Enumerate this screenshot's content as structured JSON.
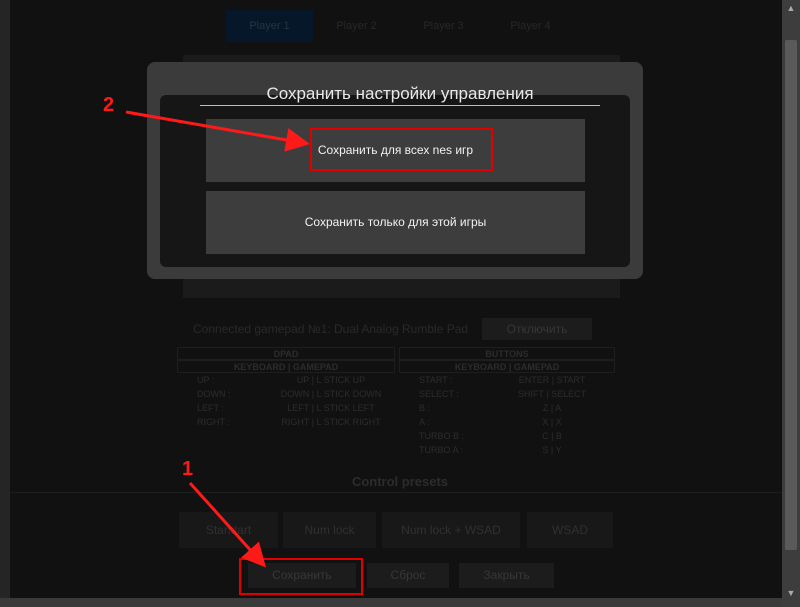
{
  "tabs": [
    "Player 1",
    "Player 2",
    "Player 3",
    "Player 4"
  ],
  "gamepad": {
    "connected_text": "Connected gamepad №1: Dual Analog Rumble Pad",
    "disconnect_label": "Отключить"
  },
  "dpad": {
    "title": "DPAD",
    "subtitle": "KEYBOARD | GAMEPAD",
    "rows": [
      {
        "key": "UP :",
        "value": "UP | L STICK UP"
      },
      {
        "key": "DOWN :",
        "value": "DOWN | L STICK DOWN"
      },
      {
        "key": "LEFT :",
        "value": "LEFT | L STICK LEFT"
      },
      {
        "key": "RIGHT :",
        "value": "RIGHT | L STICK RIGHT"
      }
    ]
  },
  "buttons": {
    "title": "BUTTONS",
    "subtitle": "KEYBOARD | GAMEPAD",
    "rows": [
      {
        "key": "START :",
        "value": "ENTER | START"
      },
      {
        "key": "SELECT :",
        "value": "SHIFT | SELECT"
      },
      {
        "key": "B :",
        "value": "Z | A"
      },
      {
        "key": "A :",
        "value": "X | X"
      },
      {
        "key": "TURBO B :",
        "value": "C | B"
      },
      {
        "key": "TURBO A :",
        "value": "S | Y"
      }
    ]
  },
  "presets": {
    "title": "Control presets",
    "items": [
      "Standart",
      "Num lock",
      "Num lock + WSAD",
      "WSAD"
    ]
  },
  "bottom": {
    "save": "Сохранить",
    "reset": "Сброс",
    "close": "Закрыть"
  },
  "modal": {
    "title": "Сохранить настройки управления",
    "save_all": "Сохранить для всех nes игр",
    "save_this": "Сохранить только для этой игры"
  },
  "annotations": {
    "one": "1",
    "two": "2",
    "color": "#e00000"
  }
}
